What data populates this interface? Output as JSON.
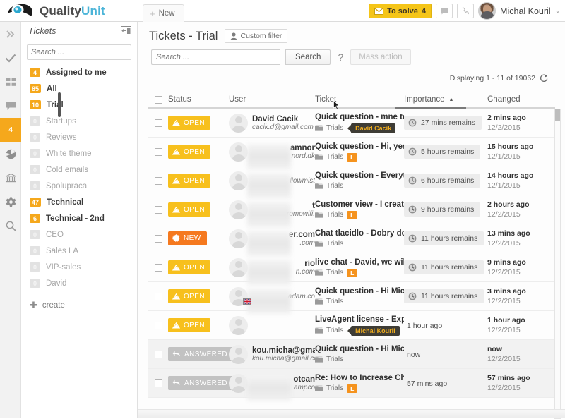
{
  "app": {
    "logo_text_part1": "Quality",
    "logo_text_part2": "Unit"
  },
  "topbar": {
    "new_tab_label": "New",
    "to_solve_label": "To solve",
    "to_solve_count": "4",
    "chat_icon": "chat-bubble-icon",
    "phone_icon": "phone-icon",
    "username": "Michal Kouril",
    "user_caret": "⌄"
  },
  "rail": {
    "items": [
      {
        "name": "collapse-expand",
        "icon": "chevrons-right-icon",
        "badge": null
      },
      {
        "name": "tasks",
        "icon": "check-icon",
        "badge": null
      },
      {
        "name": "dashboard",
        "icon": "grid-icon",
        "badge": null
      },
      {
        "name": "chats",
        "icon": "chat-icon",
        "badge": null
      },
      {
        "name": "tickets",
        "icon": "tickets-icon",
        "badge": "4",
        "active": true
      },
      {
        "name": "reports",
        "icon": "pie-chart-icon",
        "badge": null
      },
      {
        "name": "company",
        "icon": "bank-icon",
        "badge": null
      },
      {
        "name": "settings",
        "icon": "gear-icon",
        "badge": null
      },
      {
        "name": "search",
        "icon": "search-icon",
        "badge": null
      }
    ]
  },
  "sidebar": {
    "title": "Tickets",
    "collapse_icon": "panel-collapse-icon",
    "search_placeholder": "Search ...",
    "search_value": "",
    "search_icon": "search-icon",
    "items": [
      {
        "count": "4",
        "label": "Assigned to me",
        "active": true
      },
      {
        "count": "85",
        "label": "All",
        "active": true
      },
      {
        "count": "10",
        "label": "Trial",
        "active": true
      },
      {
        "count": "0",
        "label": "Startups",
        "active": false
      },
      {
        "count": "0",
        "label": "Reviews",
        "active": false
      },
      {
        "count": "0",
        "label": "White theme",
        "active": false
      },
      {
        "count": "0",
        "label": "Cold emails",
        "active": false
      },
      {
        "count": "0",
        "label": "Spolupraca",
        "active": false
      },
      {
        "count": "47",
        "label": "Technical",
        "active": true
      },
      {
        "count": "6",
        "label": "Technical - 2nd",
        "active": true
      },
      {
        "count": "0",
        "label": "CEO",
        "active": false
      },
      {
        "count": "0",
        "label": "Sales LA",
        "active": false
      },
      {
        "count": "0",
        "label": "VIP-sales",
        "active": false
      },
      {
        "count": "0",
        "label": "David",
        "active": false
      }
    ],
    "create_label": "create",
    "create_icon": "plus-icon"
  },
  "main": {
    "page_title": "Tickets - Trial",
    "custom_filter_label": "Custom filter",
    "custom_filter_icon": "user-icon",
    "search_placeholder": "Search ...",
    "search_value": "",
    "search_button_label": "Search",
    "help_label": "?",
    "mass_action_label": "Mass action",
    "displaying_label": "Displaying 1 - 11 of 19062",
    "refresh_icon": "refresh-icon"
  },
  "table": {
    "columns": [
      "Status",
      "User",
      "Ticket",
      "Importance",
      "Changed"
    ],
    "sort_column": "Importance",
    "sort_direction": "asc",
    "sort_caret": "▲",
    "rows": [
      {
        "status": "OPEN",
        "status_type": "open",
        "user_name": "David Cacik",
        "user_email": "cacik.d@gmail.com",
        "blurred": false,
        "flag": null,
        "subject": "Quick question - mne to r",
        "dept": "Trials",
        "tag_l": false,
        "assignee_tag": "David Cacik",
        "importance": "27 mins remains",
        "importance_boxed": true,
        "changed_rel": "2 mins ago",
        "changed_date": "12/2/2015"
      },
      {
        "status": "OPEN",
        "status_type": "open",
        "user_name": "amnor",
        "user_email": "nord.dk",
        "blurred": true,
        "flag": null,
        "subject": "Quick question - Hi, yes y",
        "dept": "Trials",
        "tag_l": true,
        "assignee_tag": null,
        "importance": "5 hours remains",
        "importance_boxed": true,
        "changed_rel": "15 hours ago",
        "changed_date": "12/1/2015"
      },
      {
        "status": "OPEN",
        "status_type": "open",
        "user_name": "",
        "user_email": "llowmist",
        "blurred": true,
        "flag": null,
        "subject": "Quick question - Everythi",
        "dept": "Trials",
        "tag_l": false,
        "assignee_tag": null,
        "importance": "6 hours remains",
        "importance_boxed": true,
        "changed_rel": "14 hours ago",
        "changed_date": "12/1/2015"
      },
      {
        "status": "OPEN",
        "status_type": "open",
        "user_name": "t",
        "user_email": "romowifi.",
        "blurred": true,
        "flag": null,
        "subject": "Customer view - I created",
        "dept": "Trials",
        "tag_l": true,
        "assignee_tag": null,
        "importance": "9 hours remains",
        "importance_boxed": true,
        "changed_rel": "2 hours ago",
        "changed_date": "12/2/2015"
      },
      {
        "status": "NEW",
        "status_type": "new",
        "user_name": "er.com",
        "user_email": ".com",
        "blurred": true,
        "flag": null,
        "subject": "Chat tlacidlo - Dobry den",
        "dept": "Trials",
        "tag_l": false,
        "assignee_tag": null,
        "importance": "11 hours remains",
        "importance_boxed": true,
        "changed_rel": "13 mins ago",
        "changed_date": "12/2/2015"
      },
      {
        "status": "OPEN",
        "status_type": "open",
        "user_name": "rio",
        "user_email": "n.com",
        "blurred": true,
        "flag": null,
        "subject": "live chat - David, we will t",
        "dept": "Trials",
        "tag_l": true,
        "assignee_tag": null,
        "importance": "11 hours remains",
        "importance_boxed": true,
        "changed_rel": "9 mins ago",
        "changed_date": "12/2/2015"
      },
      {
        "status": "OPEN",
        "status_type": "open",
        "user_name": "",
        "user_email": "adam.co",
        "blurred": true,
        "flag": "uk-flag-icon",
        "subject": "Quick question - Hi Micha",
        "dept": "Trials",
        "tag_l": false,
        "assignee_tag": null,
        "importance": "11 hours remains",
        "importance_boxed": true,
        "changed_rel": "3 mins ago",
        "changed_date": "12/2/2015"
      },
      {
        "status": "OPEN",
        "status_type": "open",
        "user_name": "",
        "user_email": "",
        "blurred": false,
        "flag": null,
        "subject": "LiveAgent license - Expire",
        "dept": "Trials",
        "tag_l": false,
        "assignee_tag": "Michal Kouril",
        "importance": "1 hour ago",
        "importance_boxed": false,
        "changed_rel": "1 hour ago",
        "changed_date": "12/2/2015"
      },
      {
        "status": "ANSWERED",
        "status_type": "answered",
        "user_name": "kou.micha@gmail",
        "user_email": "kou.micha@gmail.con",
        "blurred": false,
        "flag": null,
        "subject": "Quick question - Hi Micha",
        "dept": "Trials",
        "tag_l": false,
        "assignee_tag": null,
        "importance": "now",
        "importance_boxed": false,
        "changed_rel": "now",
        "changed_date": "12/2/2015"
      },
      {
        "status": "ANSWERED",
        "status_type": "answered",
        "user_name": "otcan",
        "user_email": "ampco",
        "blurred": true,
        "flag": null,
        "subject": "Re: How to Increase Chat",
        "dept": "Trials",
        "tag_l": true,
        "assignee_tag": null,
        "importance": "57 mins ago",
        "importance_boxed": false,
        "changed_rel": "57 mins ago",
        "changed_date": "12/2/2015"
      }
    ]
  },
  "colors": {
    "accent_yellow": "#f5a81c",
    "status_open": "#f7c01d",
    "status_new": "#f5791f",
    "status_answered": "#c2c2c2",
    "brand_blue": "#4ab4d8",
    "tag_orange": "#f5931e",
    "tag_dark": "#3e3c35"
  }
}
